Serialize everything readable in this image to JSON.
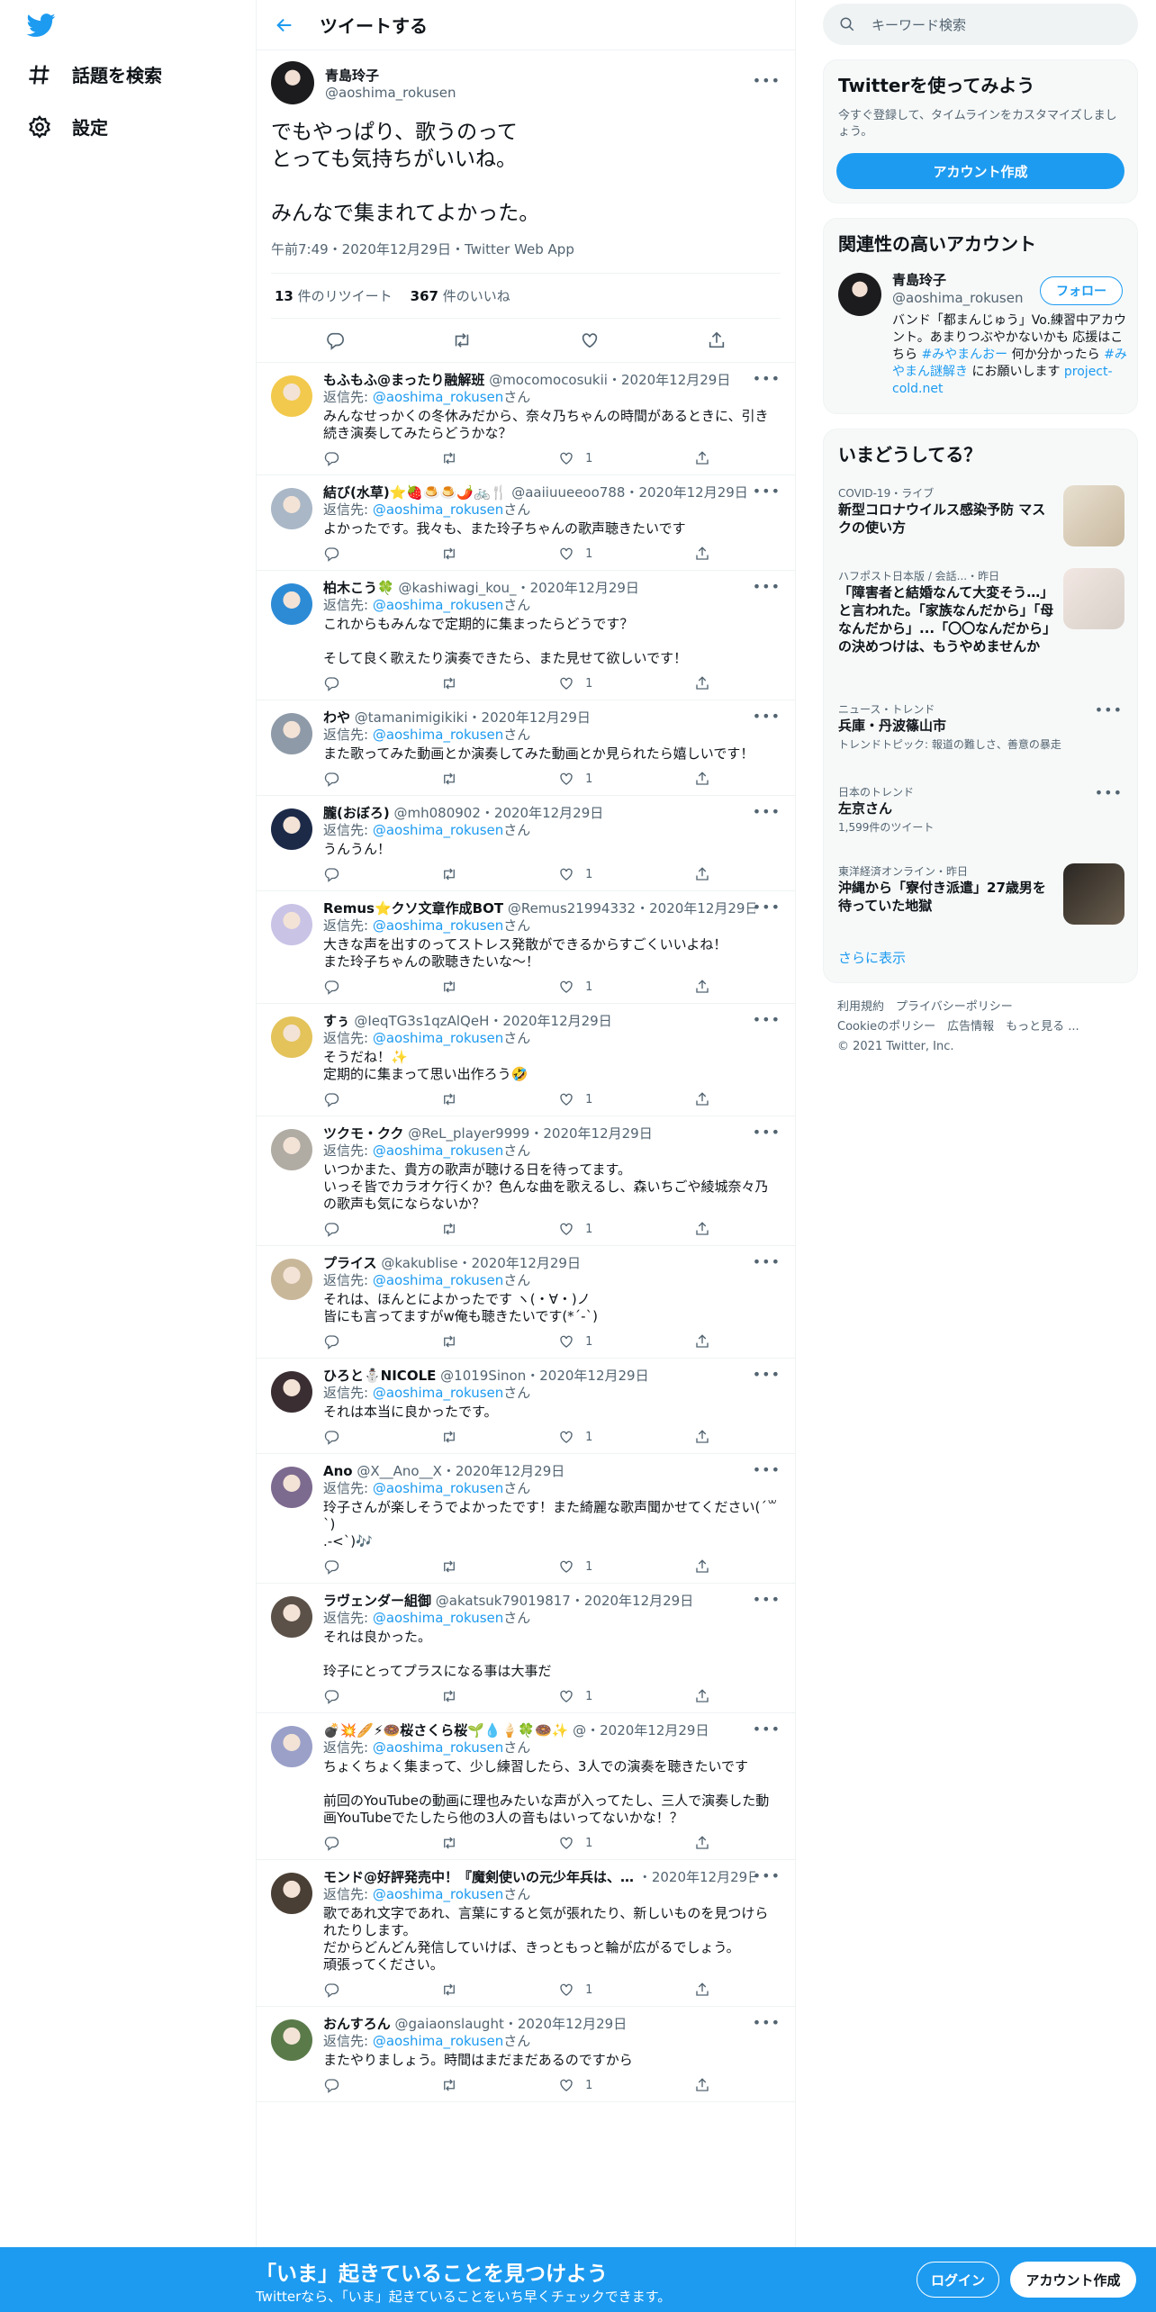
{
  "nav": {
    "explore": "話題を検索",
    "settings": "設定"
  },
  "header": {
    "title": "ツイートする"
  },
  "main_tweet": {
    "name": "青島玲子",
    "handle": "@aoshima_rokusen",
    "text": "でもやっぱり、歌うのって\nとっても気持ちがいいね。\n\nみんなで集まれてよかった。",
    "meta": "午前7:49・2020年12月29日・Twitter Web App",
    "retweets": "13",
    "retweets_label": "件のリツイート",
    "likes": "367",
    "likes_label": "件のいいね"
  },
  "reply_to_label": "返信先: ",
  "reply_to_handle": "@aoshima_rokusen",
  "reply_to_suffix": "さん",
  "replies": [
    {
      "name": "もふもふ@まったり融解班",
      "handle": "@mocomocosukii",
      "date": "2020年12月29日",
      "text": "みんなせっかくの冬休みだから、奈々乃ちゃんの時間があるときに、引き続き演奏してみたらどうかな？",
      "likes": "1",
      "avatar": "#f2c94c"
    },
    {
      "name": "結び(水草)⭐🍓🍮🍮🌶️🚲🍴",
      "handle": "@aaiiuueeoo788",
      "date": "2020年12月29日",
      "text": "よかったです。我々も、また玲子ちゃんの歌声聴きたいです",
      "likes": "1",
      "avatar": "#a9b7c6"
    },
    {
      "name": "柏木こう🍀",
      "handle": "@kashiwagi_kou_",
      "date": "2020年12月29日",
      "text": "これからもみんなで定期的に集まったらどうです？\n\nそして良く歌えたり演奏できたら、また見せて欲しいです！",
      "likes": "1",
      "avatar": "#2d8bd6"
    },
    {
      "name": "わや",
      "handle": "@tamanimigikiki",
      "date": "2020年12月29日",
      "text": "また歌ってみた動画とか演奏してみた動画とか見られたら嬉しいです！",
      "likes": "1",
      "avatar": "#8e9aa8"
    },
    {
      "name": "朧(おぼろ)",
      "handle": "@mh080902",
      "date": "2020年12月29日",
      "text": "うんうん！",
      "likes": "1",
      "avatar": "#1c2a48"
    },
    {
      "name": "Remus⭐クソ文章作成BOT",
      "handle": "@Remus21994332",
      "date": "2020年12月29日",
      "text": "大きな声を出すのってストレス発散ができるからすごくいいよね！\nまた玲子ちゃんの歌聴きたいな～！",
      "likes": "1",
      "avatar": "#c9c3e6"
    },
    {
      "name": "すぅ",
      "handle": "@IeqTG3s1qzAlQeH",
      "date": "2020年12月29日",
      "text": "そうだね！✨\n定期的に集まって思い出作ろう🤣",
      "likes": "1",
      "avatar": "#e3c35a"
    },
    {
      "name": "ツクモ・クク",
      "handle": "@ReL_player9999",
      "date": "2020年12月29日",
      "text": "いつかまた、貴方の歌声が聴ける日を待ってます。\nいっそ皆でカラオケ行くか？色んな曲を歌えるし、森いちごや綾城奈々乃の歌声も気にならないか？",
      "likes": "1",
      "avatar": "#b0aba3"
    },
    {
      "name": "プライス",
      "handle": "@kakublise",
      "date": "2020年12月29日",
      "text": "それは、ほんとによかったです ヽ(・∀・)ノ\n皆にも言ってますがw俺も聴きたいです(*´-`)",
      "likes": "1",
      "avatar": "#c9b79a"
    },
    {
      "name": "ひろと⛄NICOLE",
      "handle": "@1019Sinon",
      "date": "2020年12月29日",
      "text": "それは本当に良かったです。",
      "likes": "1",
      "avatar": "#3a2e33"
    },
    {
      "name": "Ano",
      "handle": "@X__Ano__X",
      "date": "2020年12月29日",
      "text": "玲子さんが楽しそうでよかったです！また綺麗な歌声聞かせてください(´꒳`)\n.-<`)🎶",
      "likes": "1",
      "avatar": "#7d6a8f"
    },
    {
      "name": "ラヴェンダー組御",
      "handle": "@akatsuk79019817",
      "date": "2020年12月29日",
      "text": "それは良かった。\n\n玲子にとってプラスになる事は大事だ",
      "likes": "1",
      "avatar": "#5b5148"
    },
    {
      "name": "💣💥🥖⚡🍩桜さくら桜🌱💧🍦🍀🍩✨",
      "handle": "@",
      "date": "2020年12月29日",
      "text": "ちょくちょく集まって、少し練習したら、3人での演奏を聴きたいです\n\n前回のYouTubeの動画に理也みたいな声が入ってたし、三人で演奏した動画YouTubeでたしたら他の3人の音もはいってないかな！？",
      "likes": "1",
      "avatar": "#9aa0c8"
    },
    {
      "name": "モンド@好評発売中！『魔剣使いの元少年兵は、…",
      "handle": "",
      "date": "2020年12月29日",
      "text": "歌であれ文字であれ、言葉にすると気が張れたり、新しいものを見つけられたりします。\nだからどんどん発信していけば、きっともっと輪が広がるでしょう。\n頑張ってください。",
      "likes": "1",
      "avatar": "#4a3f35"
    },
    {
      "name": "おんすろん",
      "handle": "@gaiaonslaught",
      "date": "2020年12月29日",
      "text": "またやりましょう。時間はまだまだあるのですから",
      "likes": "1",
      "avatar": "#5a7a4a"
    }
  ],
  "search": {
    "placeholder": "キーワード検索"
  },
  "signup_card": {
    "title": "Twitterを使ってみよう",
    "sub": "今すぐ登録して、タイムラインをカスタマイズしましょう。",
    "button": "アカウント作成"
  },
  "related": {
    "title": "関連性の高いアカウント",
    "name": "青島玲子",
    "handle": "@aoshima_rokusen",
    "follow": "フォロー",
    "bio_a": "バンド「都まんじゅう」Vo.練習中アカウント。あまりつぶやかないかも 応援はこちら ",
    "bio_tag1": "#みやまんおー",
    "bio_b": " 何か分かったら ",
    "bio_tag2": "#みやまん謎解き",
    "bio_c": " にお願いします ",
    "bio_link": "project-cold.net"
  },
  "trends": {
    "title": "いまどうしてる？",
    "items": [
      {
        "cat": "COVID-19・ライブ",
        "title": "新型コロナウイルス感染予防 マスクの使い方",
        "sub": ""
      },
      {
        "cat": "ハフポスト日本版 / 会話...・昨日",
        "title": "「障害者と結婚なんて大変そう…」と言われた。「家族なんだから」「母なんだから」...「〇〇なんだから」の決めつけは、もうやめませんか",
        "sub": ""
      },
      {
        "cat": "ニュース・トレンド",
        "title": "兵庫・丹波篠山市",
        "sub": "トレンドトピック: 報道の難しさ、善意の暴走"
      },
      {
        "cat": "日本のトレンド",
        "title": "左京さん",
        "sub": "1,599件のツイート"
      },
      {
        "cat": "東洋経済オンライン・昨日",
        "title": "沖縄から「寮付き派遣」27歳男を待っていた地獄",
        "sub": ""
      }
    ],
    "more": "さらに表示"
  },
  "footer": {
    "l1": "利用規約　プライバシーポリシー",
    "l2": "Cookieのポリシー　広告情報　もっと見る ...",
    "l3": "© 2021 Twitter, Inc."
  },
  "bottombar": {
    "title": "「いま」起きていることを見つけよう",
    "sub": "Twitterなら、「いま」起きていることをいち早くチェックできます。",
    "login": "ログイン",
    "signup": "アカウント作成"
  }
}
